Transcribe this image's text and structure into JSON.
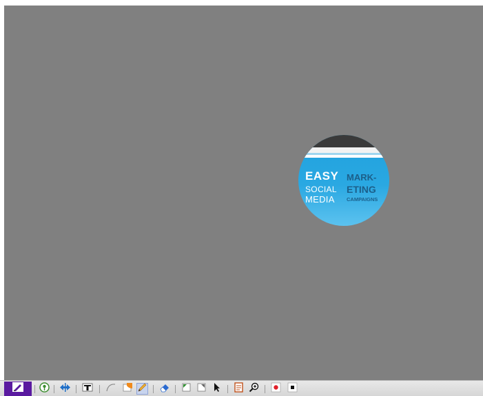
{
  "slide": {
    "background_color": "#808080",
    "spotlight": {
      "line1": "EASY",
      "line2": "SOCIAL",
      "line3": "MEDIA",
      "right1": "MARK-",
      "right2": "ETING",
      "right3": "CAMPAIGNS"
    }
  },
  "toolbar": {
    "tools": [
      {
        "name": "pen-menu-icon"
      },
      {
        "name": "add-slide-icon"
      },
      {
        "name": "navigate-icon"
      },
      {
        "name": "text-icon"
      },
      {
        "name": "curve-icon"
      },
      {
        "name": "shape-icon"
      },
      {
        "name": "pencil-icon"
      },
      {
        "name": "eraser-icon"
      },
      {
        "name": "undo-icon"
      },
      {
        "name": "redo-icon"
      },
      {
        "name": "pointer-icon"
      },
      {
        "name": "notes-icon"
      },
      {
        "name": "zoom-icon"
      },
      {
        "name": "record-icon"
      },
      {
        "name": "stop-icon"
      }
    ],
    "accent_color": "#5a1aa0",
    "record_color": "#e0202a"
  }
}
